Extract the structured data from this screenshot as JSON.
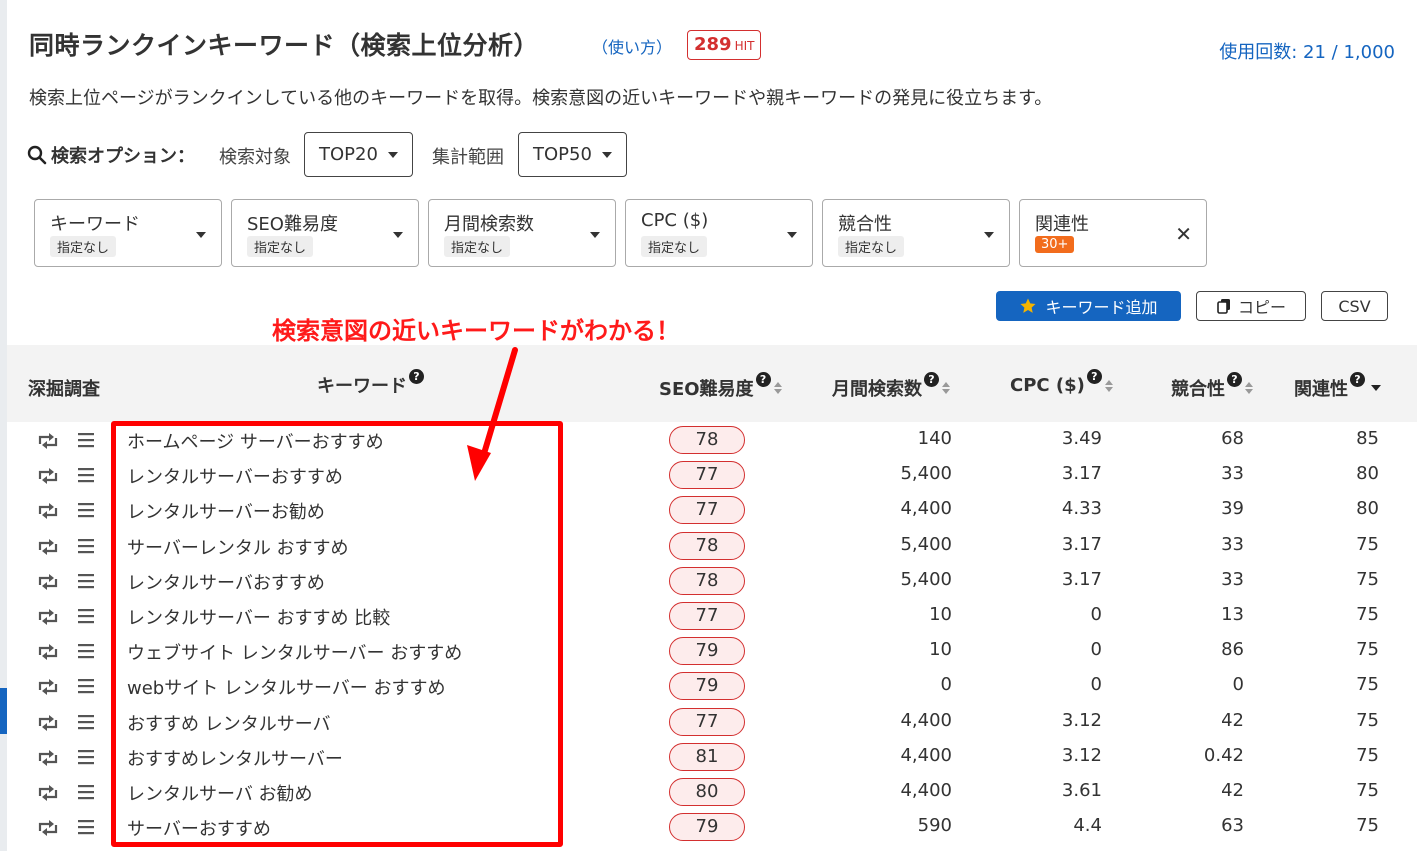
{
  "header": {
    "title": "同時ランクインキーワード（検索上位分析）",
    "howto": "（使い方）",
    "hit_count": "289",
    "hit_unit": "HIT",
    "usage": "使用回数: 21 / 1,000"
  },
  "description": "検索上位ページがランクインしている他のキーワードを取得。検索意図の近いキーワードや親キーワードの発見に役立ちます。",
  "options": {
    "label": "検索オプション：",
    "target_label": "検索対象",
    "target_value": "TOP20",
    "range_label": "集計範囲",
    "range_value": "TOP50"
  },
  "filters": [
    {
      "label": "キーワード",
      "value": "指定なし"
    },
    {
      "label": "SEO難易度",
      "value": "指定なし"
    },
    {
      "label": "月間検索数",
      "value": "指定なし"
    },
    {
      "label": "CPC ($)",
      "value": "指定なし"
    },
    {
      "label": "競合性",
      "value": "指定なし"
    },
    {
      "label": "関連性",
      "value": "30+"
    }
  ],
  "actions": {
    "add_keyword": "キーワード追加",
    "copy": "コピー",
    "csv": "CSV"
  },
  "annotation": "検索意図の近いキーワードがわかる！",
  "table": {
    "headers": {
      "dig": "深掘調査",
      "keyword": "キーワード",
      "seo": "SEO難易度",
      "volume": "月間検索数",
      "cpc": "CPC ($)",
      "competition": "競合性",
      "relevance": "関連性"
    },
    "rows": [
      {
        "keyword": "ホームページ サーバーおすすめ",
        "seo": "78",
        "volume": "140",
        "cpc": "3.49",
        "competition": "68",
        "relevance": "85"
      },
      {
        "keyword": "レンタルサーバーおすすめ",
        "seo": "77",
        "volume": "5,400",
        "cpc": "3.17",
        "competition": "33",
        "relevance": "80"
      },
      {
        "keyword": "レンタルサーバーお勧め",
        "seo": "77",
        "volume": "4,400",
        "cpc": "4.33",
        "competition": "39",
        "relevance": "80"
      },
      {
        "keyword": "サーバーレンタル おすすめ",
        "seo": "78",
        "volume": "5,400",
        "cpc": "3.17",
        "competition": "33",
        "relevance": "75"
      },
      {
        "keyword": "レンタルサーバおすすめ",
        "seo": "78",
        "volume": "5,400",
        "cpc": "3.17",
        "competition": "33",
        "relevance": "75"
      },
      {
        "keyword": "レンタルサーバー おすすめ 比較",
        "seo": "77",
        "volume": "10",
        "cpc": "0",
        "competition": "13",
        "relevance": "75"
      },
      {
        "keyword": "ウェブサイト レンタルサーバー おすすめ",
        "seo": "79",
        "volume": "10",
        "cpc": "0",
        "competition": "86",
        "relevance": "75"
      },
      {
        "keyword": "webサイト レンタルサーバー おすすめ",
        "seo": "79",
        "volume": "0",
        "cpc": "0",
        "competition": "0",
        "relevance": "75"
      },
      {
        "keyword": "おすすめ レンタルサーバ",
        "seo": "77",
        "volume": "4,400",
        "cpc": "3.12",
        "competition": "42",
        "relevance": "75"
      },
      {
        "keyword": "おすすめレンタルサーバー",
        "seo": "81",
        "volume": "4,400",
        "cpc": "3.12",
        "competition": "0.42",
        "relevance": "75"
      },
      {
        "keyword": "レンタルサーバ お勧め",
        "seo": "80",
        "volume": "4,400",
        "cpc": "3.61",
        "competition": "42",
        "relevance": "75"
      },
      {
        "keyword": "サーバーおすすめ",
        "seo": "79",
        "volume": "590",
        "cpc": "4.4",
        "competition": "63",
        "relevance": "75"
      }
    ]
  },
  "colors": {
    "accent": "#1565c0",
    "hit_red": "#d32f2f",
    "annotation_red": "#ff0000",
    "relevance_badge": "#f26c1c"
  }
}
